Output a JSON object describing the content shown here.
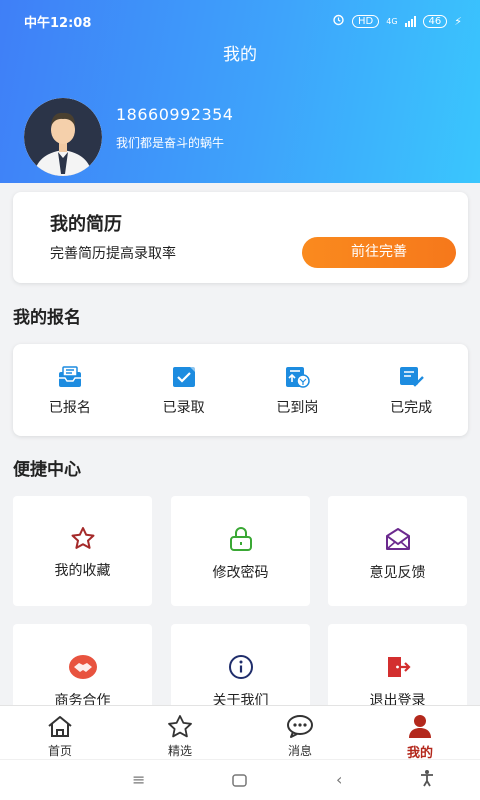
{
  "status_bar": {
    "time": "中午12:08",
    "network": "4G",
    "hd": "HD",
    "battery": "46"
  },
  "header": {
    "title": "我的",
    "phone": "18660992354",
    "motto": "我们都是奋斗的蜗牛"
  },
  "resume": {
    "title": "我的简历",
    "subtitle": "完善简历提高录取率",
    "button_label": "前往完善"
  },
  "my_applications": {
    "title": "我的报名",
    "items": [
      {
        "label": "已报名",
        "icon": "inbox-icon"
      },
      {
        "label": "已录取",
        "icon": "checkbox-icon"
      },
      {
        "label": "已到岗",
        "icon": "upload-calendar-icon"
      },
      {
        "label": "已完成",
        "icon": "document-check-icon"
      }
    ]
  },
  "shortcuts": {
    "title": "便捷中心",
    "items": [
      {
        "label": "我的收藏",
        "icon": "star-icon"
      },
      {
        "label": "修改密码",
        "icon": "lock-icon"
      },
      {
        "label": "意见反馈",
        "icon": "envelope-icon"
      },
      {
        "label": "商务合作",
        "icon": "handshake-icon"
      },
      {
        "label": "关于我们",
        "icon": "info-icon"
      },
      {
        "label": "退出登录",
        "icon": "logout-icon"
      }
    ]
  },
  "tabbar": {
    "items": [
      {
        "label": "首页",
        "icon": "home-icon"
      },
      {
        "label": "精选",
        "icon": "star-outline-icon"
      },
      {
        "label": "消息",
        "icon": "chat-icon"
      },
      {
        "label": "我的",
        "icon": "user-icon",
        "active": true
      }
    ]
  },
  "colors": {
    "header_start": "#3f7ff7",
    "header_end": "#3ac6fd",
    "accent_orange": "#f6781b",
    "active_tab": "#b3281c",
    "icon_blue": "#1d8ce0"
  }
}
